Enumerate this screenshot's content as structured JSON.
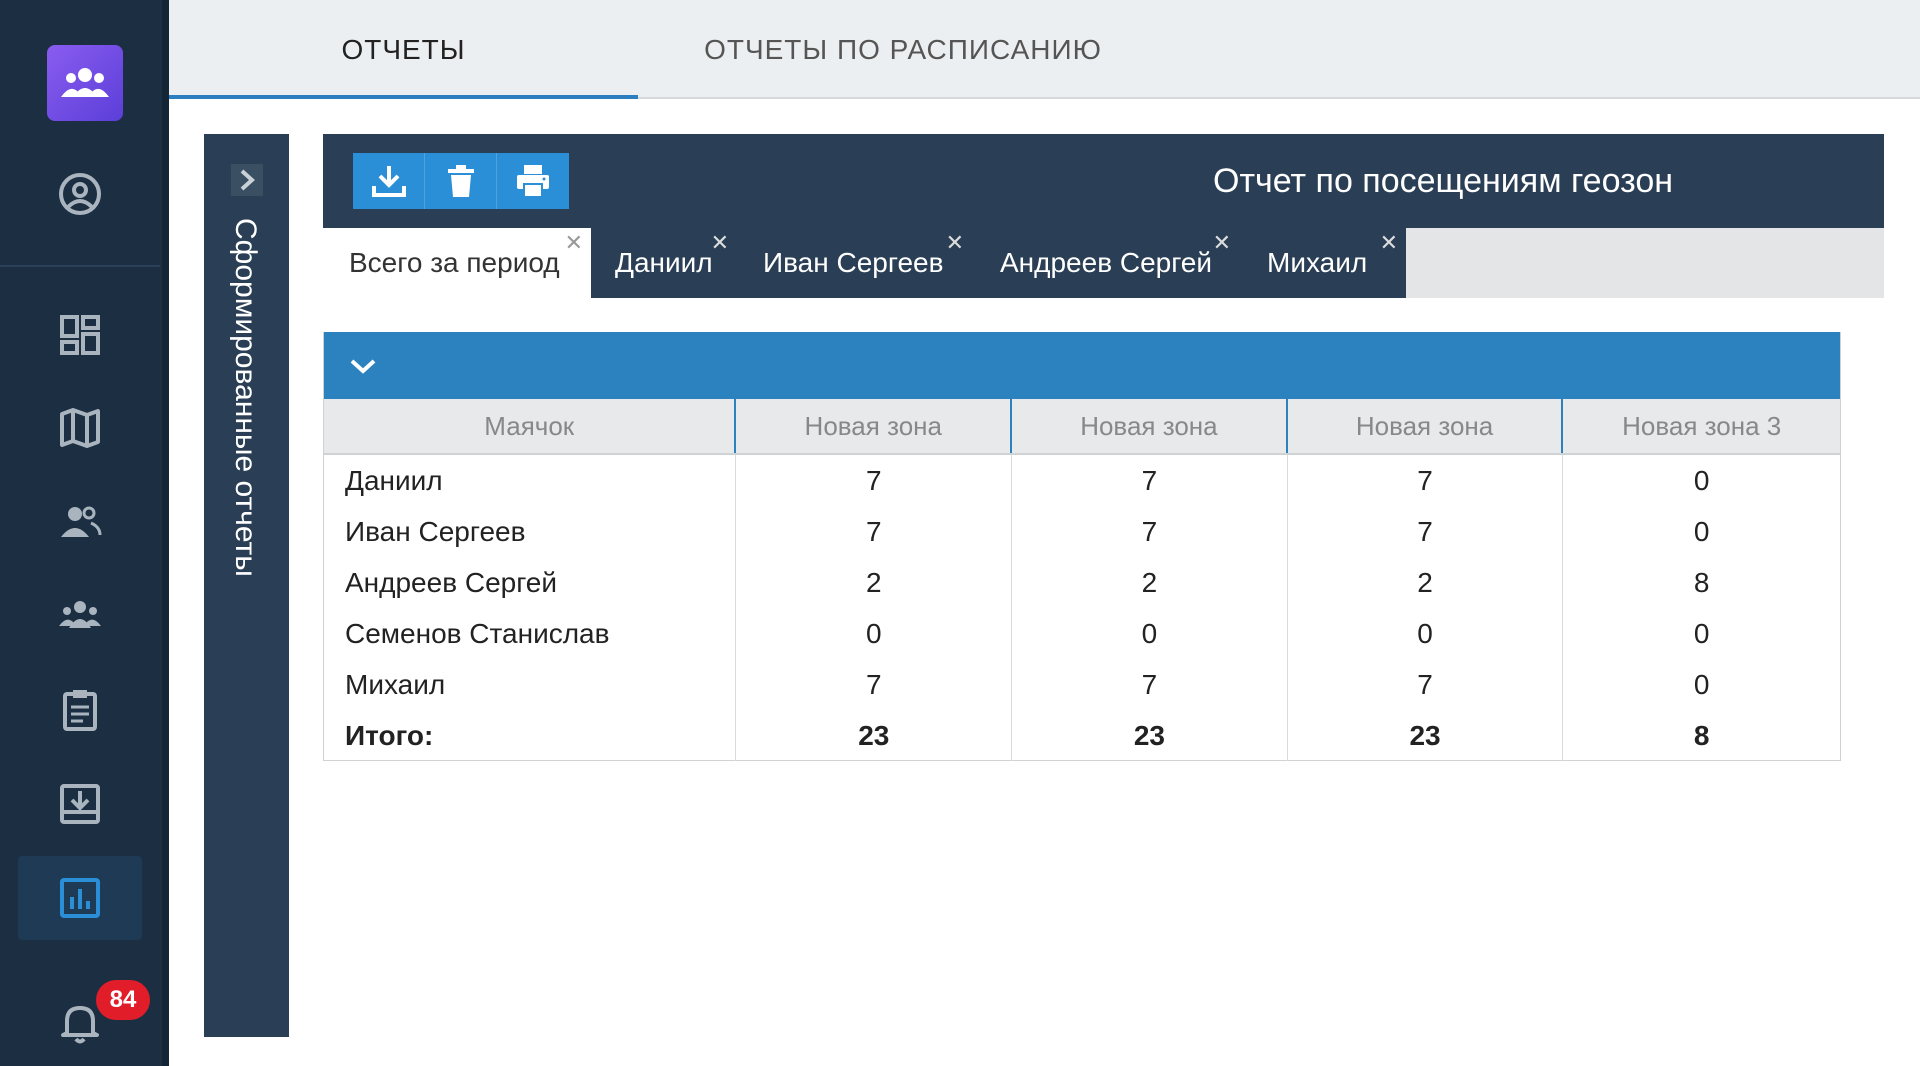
{
  "top_tabs": [
    {
      "label": "ОТЧЕТЫ",
      "active": true
    },
    {
      "label": "ОТЧЕТЫ ПО РАСПИСАНИЮ",
      "active": false
    }
  ],
  "side_panel": {
    "title": "Сформированные отчеты"
  },
  "report": {
    "title": "Отчет по посещениям геозон",
    "toolbar": [
      "download-icon",
      "trash-icon",
      "print-icon"
    ]
  },
  "sub_tabs": [
    {
      "label": "Всего за период",
      "active": true
    },
    {
      "label": "Даниил",
      "active": false
    },
    {
      "label": "Иван Сергеев",
      "active": false
    },
    {
      "label": "Андреев Сергей",
      "active": false
    },
    {
      "label": "Михаил",
      "active": false
    }
  ],
  "table": {
    "columns": [
      "Маячок",
      "Новая зона",
      "Новая зона",
      "Новая зона",
      "Новая зона 3"
    ],
    "rows": [
      [
        "Даниил",
        "7",
        "7",
        "7",
        "0"
      ],
      [
        "Иван Сергеев",
        "7",
        "7",
        "7",
        "0"
      ],
      [
        "Андреев Сергей",
        "2",
        "2",
        "2",
        "8"
      ],
      [
        "Семенов Станислав",
        "0",
        "0",
        "0",
        "0"
      ],
      [
        "Михаил",
        "7",
        "7",
        "7",
        "0"
      ]
    ],
    "total": [
      "Итого:",
      "23",
      "23",
      "23",
      "8"
    ]
  },
  "notifications": {
    "count": "84"
  },
  "colors": {
    "rail": "#1b2e42",
    "header": "#2a3f55",
    "accent": "#2b8fd8",
    "badge": "#e11d2a"
  }
}
